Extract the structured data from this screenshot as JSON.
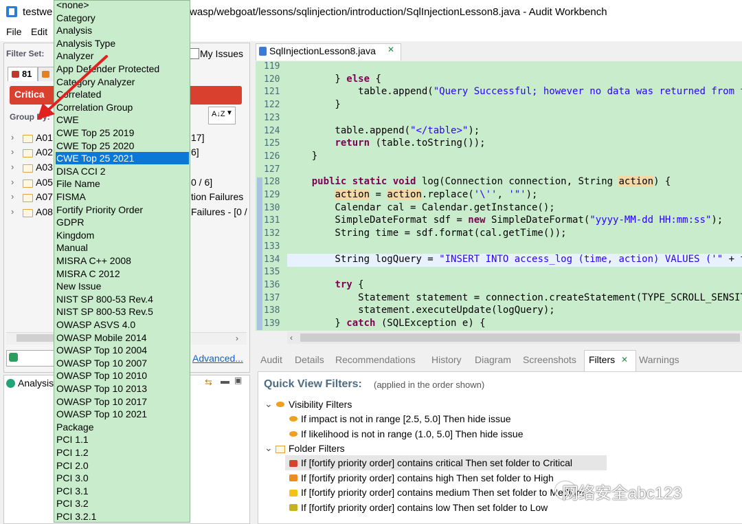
{
  "window": {
    "title_left": "testwe",
    "title_right": "wasp/webgoat/lessons/sqlinjection/introduction/SqlInjectionLesson8.java - Audit Workbench"
  },
  "menu": [
    "File",
    "Edit"
  ],
  "left_pane": {
    "filter_set_label": "Filter Set:",
    "my_issues_label": "My Issues",
    "tab_count": "81",
    "critical_label": "Critica",
    "group_by_label": "Group By:",
    "sort_label": "A↓Z",
    "tree": [
      {
        "label": "A01",
        "tail": "17]"
      },
      {
        "label": "A02",
        "tail": "6]"
      },
      {
        "label": "A03",
        "tail": ""
      },
      {
        "label": "A05",
        "tail": "0 / 6]"
      },
      {
        "label": "A07",
        "tail": "tion Failures"
      },
      {
        "label": "A08",
        "tail": "Failures - [0 /"
      }
    ],
    "advanced_link": "Advanced...",
    "analysis_label": "Analysis"
  },
  "dropdown": {
    "items": [
      "<none>",
      "Category",
      "Analysis",
      "Analysis Type",
      "Analyzer",
      "App Defender Protected",
      "Category Analyzer",
      "Correlated",
      "Correlation Group",
      "CWE",
      "CWE Top 25 2019",
      "CWE Top 25 2020",
      "CWE Top 25 2021",
      "DISA CCI 2",
      "File Name",
      "FISMA",
      "Fortify Priority Order",
      "GDPR",
      "Kingdom",
      "Manual",
      "MISRA C++ 2008",
      "MISRA C 2012",
      "New Issue",
      "NIST SP 800-53 Rev.4",
      "NIST SP 800-53 Rev.5",
      "OWASP ASVS 4.0",
      "OWASP Mobile 2014",
      "OWASP Top 10 2004",
      "OWASP Top 10 2007",
      "OWASP Top 10 2010",
      "OWASP Top 10 2013",
      "OWASP Top 10 2017",
      "OWASP Top 10 2021",
      "Package",
      "PCI 1.1",
      "PCI 1.2",
      "PCI 2.0",
      "PCI 3.0",
      "PCI 3.1",
      "PCI 3.2",
      "PCI 3.2.1"
    ],
    "selected": "CWE Top 25 2021"
  },
  "editor": {
    "tab_label": "SqlInjectionLesson8.java",
    "lines": [
      {
        "n": "119",
        "code": ""
      },
      {
        "n": "120",
        "code": "        } else {"
      },
      {
        "n": "121",
        "code": "            table.append(\"Query Successful; however no data was returned from t"
      },
      {
        "n": "122",
        "code": "        }"
      },
      {
        "n": "123",
        "code": ""
      },
      {
        "n": "124",
        "code": "        table.append(\"</table>\");"
      },
      {
        "n": "125",
        "code": "        return (table.toString());"
      },
      {
        "n": "126",
        "code": "    }"
      },
      {
        "n": "127",
        "code": ""
      },
      {
        "n": "128",
        "code": "    public static void log(Connection connection, String action) {"
      },
      {
        "n": "129",
        "code": "        action = action.replace('\\'', '\"');"
      },
      {
        "n": "130",
        "code": "        Calendar cal = Calendar.getInstance();"
      },
      {
        "n": "131",
        "code": "        SimpleDateFormat sdf = new SimpleDateFormat(\"yyyy-MM-dd HH:mm:ss\");"
      },
      {
        "n": "132",
        "code": "        String time = sdf.format(cal.getTime());"
      },
      {
        "n": "133",
        "code": ""
      },
      {
        "n": "134",
        "code": "        String logQuery = \"INSERT INTO access_log (time, action) VALUES ('\" + t"
      },
      {
        "n": "135",
        "code": ""
      },
      {
        "n": "136",
        "code": "        try {"
      },
      {
        "n": "137",
        "code": "            Statement statement = connection.createStatement(TYPE_SCROLL_SENSIT"
      },
      {
        "n": "138",
        "code": "            statement.executeUpdate(logQuery);"
      },
      {
        "n": "139",
        "code": "        } catch (SQLException e) {"
      }
    ]
  },
  "lower_tabs": [
    "Audit",
    "Details",
    "Recommendations",
    "History",
    "Diagram",
    "Screenshots",
    "Filters",
    "Warnings"
  ],
  "filters": {
    "title": "Quick View Filters:",
    "subtitle": "(applied in the order shown)",
    "visibility_group": "Visibility Filters",
    "visibility_items": [
      "If impact is not in range [2.5, 5.0] Then hide issue",
      "If likelihood is not in range (1.0, 5.0] Then hide issue"
    ],
    "folder_group": "Folder Filters",
    "folder_items": [
      {
        "text": "If [fortify priority order] contains critical Then set folder to Critical",
        "color": "#d9412e"
      },
      {
        "text": "If [fortify priority order] contains high Then set folder to High",
        "color": "#ee8a1e"
      },
      {
        "text": "If [fortify priority order] contains medium Then set folder to Medium",
        "color": "#f3c21a"
      },
      {
        "text": "If [fortify priority order] contains low Then set folder to Low",
        "color": "#c8b21a"
      }
    ]
  },
  "watermark": "网络安全abc123"
}
